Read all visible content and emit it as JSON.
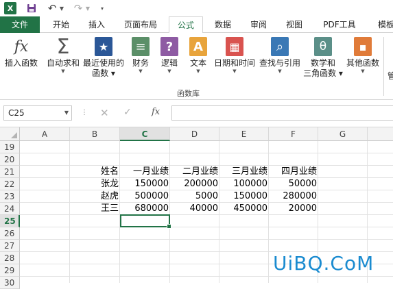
{
  "quick_access": {
    "app_icon": "excel-icon",
    "app_letter": "X",
    "save_icon": "save-icon",
    "undo_icon": "undo-icon",
    "redo_icon": "redo-icon"
  },
  "tabs": [
    {
      "label": "文件"
    },
    {
      "label": "开始"
    },
    {
      "label": "插入"
    },
    {
      "label": "页面布局"
    },
    {
      "label": "公式"
    },
    {
      "label": "数据"
    },
    {
      "label": "审阅"
    },
    {
      "label": "视图"
    },
    {
      "label": "PDF工具"
    },
    {
      "label": "模板"
    }
  ],
  "ribbon": {
    "buttons": [
      {
        "line1": "插入函数",
        "line2": "",
        "icon": "insert-function-icon",
        "glyph": "fx",
        "color": "#444444",
        "dropdown": false
      },
      {
        "line1": "自动求和",
        "line2": "",
        "icon": "sum-icon",
        "glyph": "Σ",
        "color": "#555555",
        "dropdown": true
      },
      {
        "line1": "最近使用的",
        "line2": "函数",
        "icon": "star-icon",
        "glyph": "★",
        "color": "#2b5797",
        "dropdown": true
      },
      {
        "line1": "财务",
        "line2": "",
        "icon": "financial-icon",
        "glyph": "≡",
        "color": "#5b8f68",
        "dropdown": true
      },
      {
        "line1": "逻辑",
        "line2": "",
        "icon": "logical-icon",
        "glyph": "?",
        "color": "#8e5ba3",
        "dropdown": true
      },
      {
        "line1": "文本",
        "line2": "",
        "icon": "text-icon",
        "glyph": "A",
        "color": "#e8a43c",
        "dropdown": true
      },
      {
        "line1": "日期和时间",
        "line2": "",
        "icon": "date-time-icon",
        "glyph": "▦",
        "color": "#d9534f",
        "dropdown": true
      },
      {
        "line1": "查找与引用",
        "line2": "",
        "icon": "lookup-icon",
        "glyph": "⌕",
        "color": "#3a78b5",
        "dropdown": true
      },
      {
        "line1": "数学和",
        "line2": "三角函数",
        "icon": "math-trig-icon",
        "glyph": "θ",
        "color": "#5b8f88",
        "dropdown": true
      },
      {
        "line1": "其他函数",
        "line2": "",
        "icon": "more-functions-icon",
        "glyph": "▪",
        "color": "#e07b39",
        "dropdown": true
      }
    ],
    "group_label": "函数库",
    "partial_next": "管"
  },
  "formula_bar": {
    "name_box": "C25",
    "cancel_icon": "cancel-icon",
    "enter_icon": "enter-icon",
    "fx_label": "fx",
    "formula": ""
  },
  "sheet": {
    "columns": [
      "A",
      "B",
      "C",
      "D",
      "E",
      "F",
      "G"
    ],
    "rows": [
      "19",
      "20",
      "21",
      "22",
      "23",
      "24",
      "25",
      "26",
      "27",
      "28",
      "29",
      "30"
    ],
    "selected_cell": "C25",
    "cells": {
      "B21": "姓名",
      "C21": "一月业绩",
      "D21": "二月业绩",
      "E21": "三月业绩",
      "F21": "四月业绩",
      "B22": "张龙",
      "C22": "150000",
      "D22": "200000",
      "E22": "100000",
      "F22": "50000",
      "B23": "赵虎",
      "C23": "500000",
      "D23": "5000",
      "E23": "150000",
      "F23": "280000",
      "B24": "王三",
      "C24": "680000",
      "D24": "40000",
      "E24": "450000",
      "F24": "20000"
    }
  },
  "watermark": "UiBQ.CoM"
}
